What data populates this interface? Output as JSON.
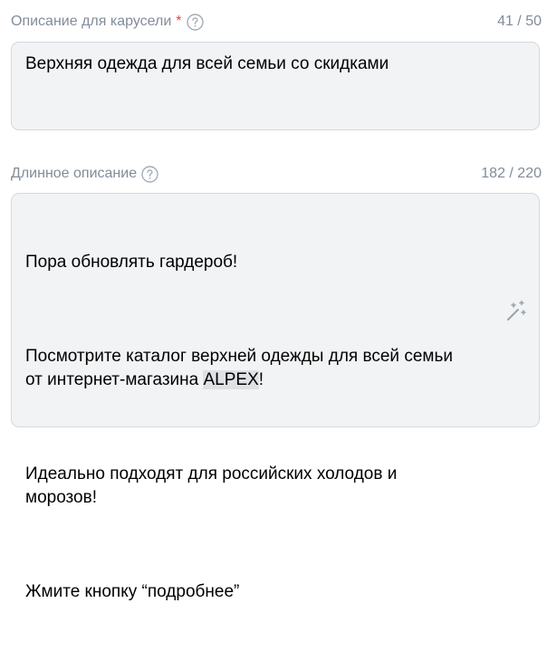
{
  "carousel": {
    "label": "Описание для карусели",
    "required_mark": "*",
    "counter": "41 / 50",
    "value": "Верхняя одежда для всей семьи со скидками"
  },
  "long": {
    "label": "Длинное описание",
    "counter": "182 / 220",
    "p1": "Пора обновлять гардероб!",
    "p2_before": "Посмотрите каталог верхней одежды для всей семьи\nот интернет-магазина ",
    "p2_highlight": "ALPEX",
    "p2_after": "!",
    "p3": "Идеально подходят для российских холодов и\nморозов!",
    "p4": "Жмите кнопку “подробнее”"
  },
  "icons": {
    "help": "question-circle-icon",
    "magic": "magic-wand-icon"
  },
  "colors": {
    "label": "#818c99",
    "required": "#e64646",
    "field_bg": "#f2f3f5",
    "field_border": "#d3d9de",
    "highlight": "#dfe1e5"
  }
}
